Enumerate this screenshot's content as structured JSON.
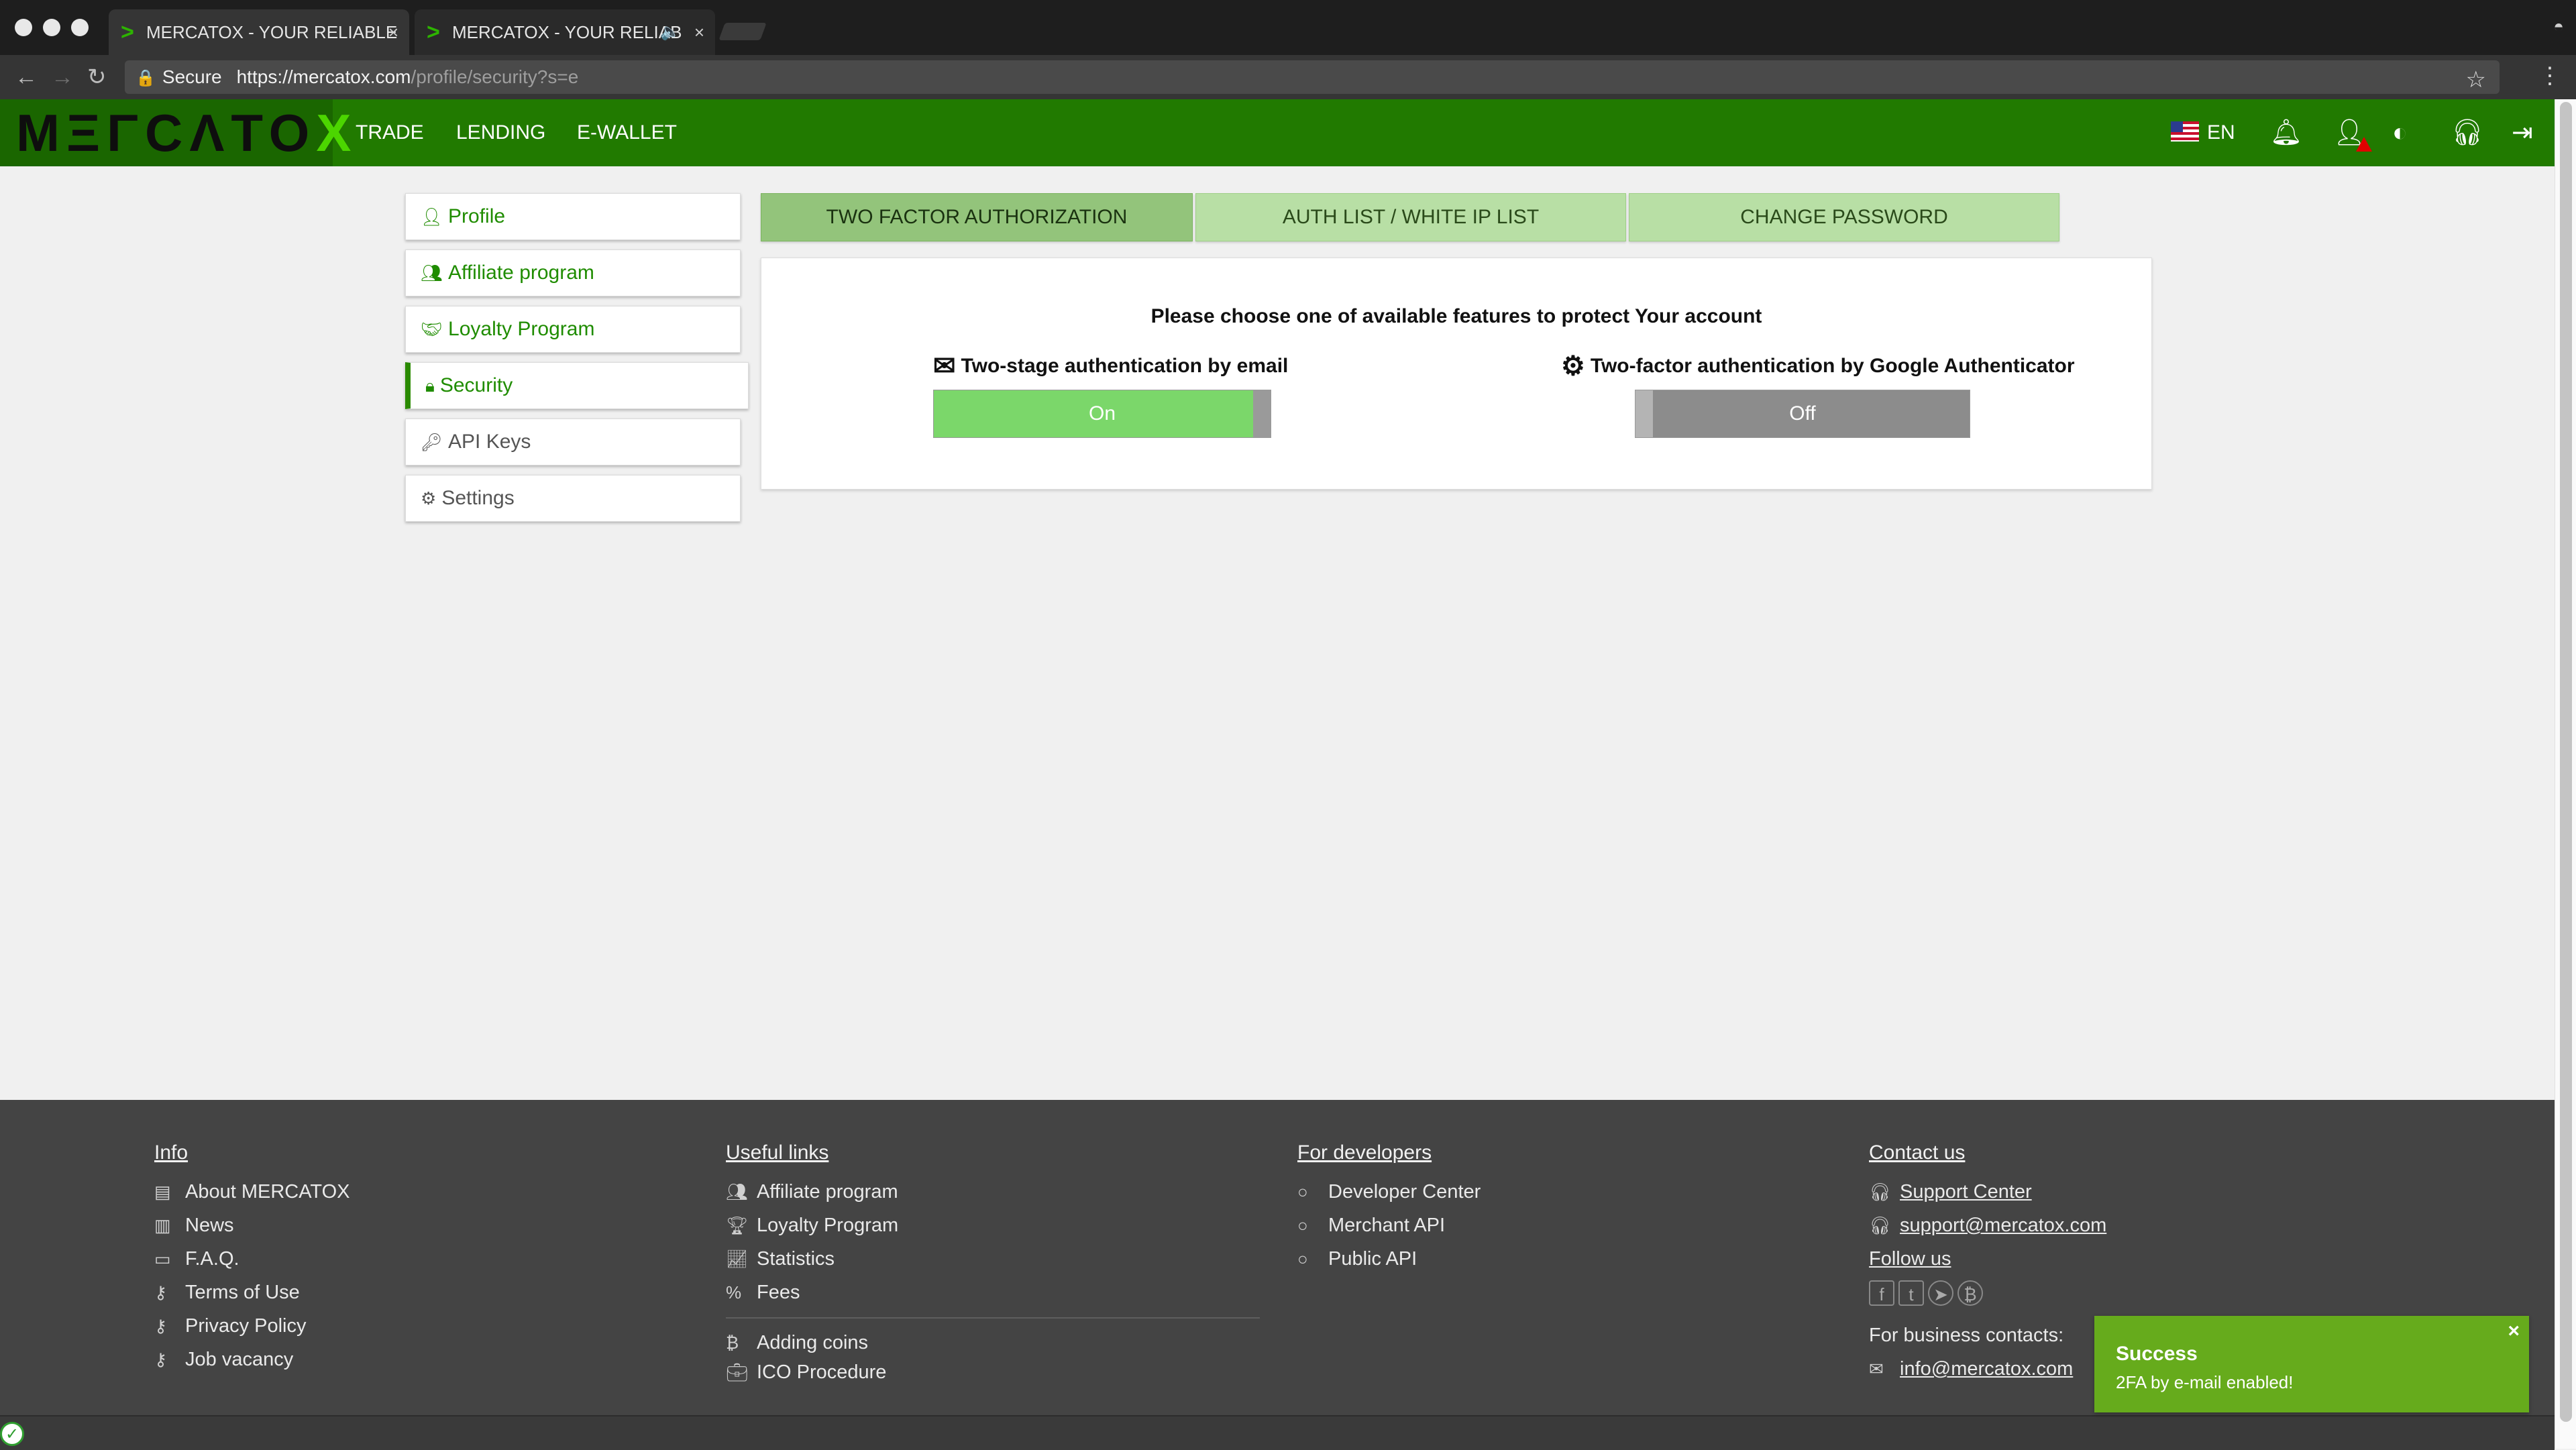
{
  "browser": {
    "tabs": [
      {
        "title": "MERCATOX - YOUR RELIABLE",
        "close": "×"
      },
      {
        "title": "MERCATOX - YOUR RELIAB",
        "close": "×"
      }
    ],
    "address": {
      "secure_label": "Secure",
      "url_host": "https://mercatox.com",
      "url_path": "/profile/security?s=e"
    }
  },
  "header": {
    "logo_main": "MΞΓCΛTO",
    "logo_x": "X",
    "nav": [
      "TRADE",
      "LENDING",
      "E-WALLET"
    ],
    "language": "EN"
  },
  "sidebar": {
    "items": [
      {
        "label": "Profile"
      },
      {
        "label": "Affiliate program"
      },
      {
        "label": "Loyalty Program"
      },
      {
        "label": "Security"
      },
      {
        "label": "API Keys"
      },
      {
        "label": "Settings"
      }
    ],
    "active": "Security"
  },
  "security": {
    "tabs": [
      "TWO FACTOR AUTHORIZATION",
      "AUTH LIST / WHITE IP LIST",
      "CHANGE PASSWORD"
    ],
    "active_tab": "TWO FACTOR AUTHORIZATION",
    "heading": "Please choose one of available features to protect Your account",
    "email": {
      "label": "Two-stage authentication by email",
      "state": "On"
    },
    "google": {
      "label": "Two-factor authentication by Google Authenticator",
      "state": "Off"
    },
    "colors": {
      "on": "#7bd76a",
      "off": "#8c8c8c",
      "brand_green": "#217a00"
    }
  },
  "footer": {
    "info": {
      "title": "Info",
      "items": [
        "About MERCATOX",
        "News",
        "F.A.Q.",
        "Terms of Use",
        "Privacy Policy",
        "Job vacancy"
      ]
    },
    "useful": {
      "title": "Useful links",
      "items": [
        "Affiliate program",
        "Loyalty Program",
        "Statistics",
        "Fees"
      ],
      "extra": [
        "Adding coins",
        "ICO Procedure"
      ]
    },
    "developers": {
      "title": "For developers",
      "items": [
        "Developer Center",
        "Merchant API",
        "Public API"
      ]
    },
    "contact": {
      "title": "Contact us",
      "support_center": "Support Center",
      "support_email": "support@mercatox.com",
      "follow_us": "Follow us",
      "business_label": "For business contacts:",
      "business_email": "info@mercatox.com"
    }
  },
  "toast": {
    "title": "Success",
    "message": "2FA by e-mail enabled!",
    "close": "×"
  }
}
